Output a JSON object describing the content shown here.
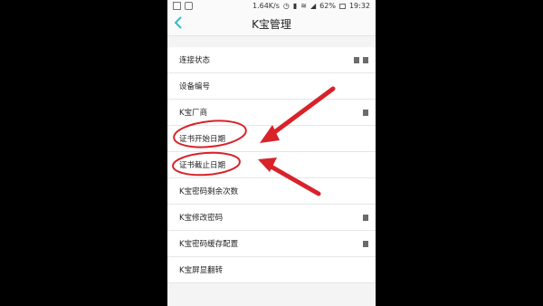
{
  "status_bar": {
    "network_speed": "1.64K/s",
    "battery": "62%",
    "time": "19:32"
  },
  "nav": {
    "back_icon": "chevron-left-icon",
    "title": "K宝管理"
  },
  "list": {
    "items": [
      {
        "label": "连接状态"
      },
      {
        "label": "设备编号"
      },
      {
        "label": "K宝厂商"
      },
      {
        "label": "证书开始日期"
      },
      {
        "label": "证书截止日期"
      },
      {
        "label": "K宝密码剩余次数"
      },
      {
        "label": "K宝修改密码"
      },
      {
        "label": "K宝密码缓存配置"
      },
      {
        "label": "K宝屏显翻转"
      }
    ]
  },
  "annotations": {
    "color": "#d8232a",
    "marks": [
      "circle",
      "circle",
      "arrow",
      "arrow"
    ]
  }
}
